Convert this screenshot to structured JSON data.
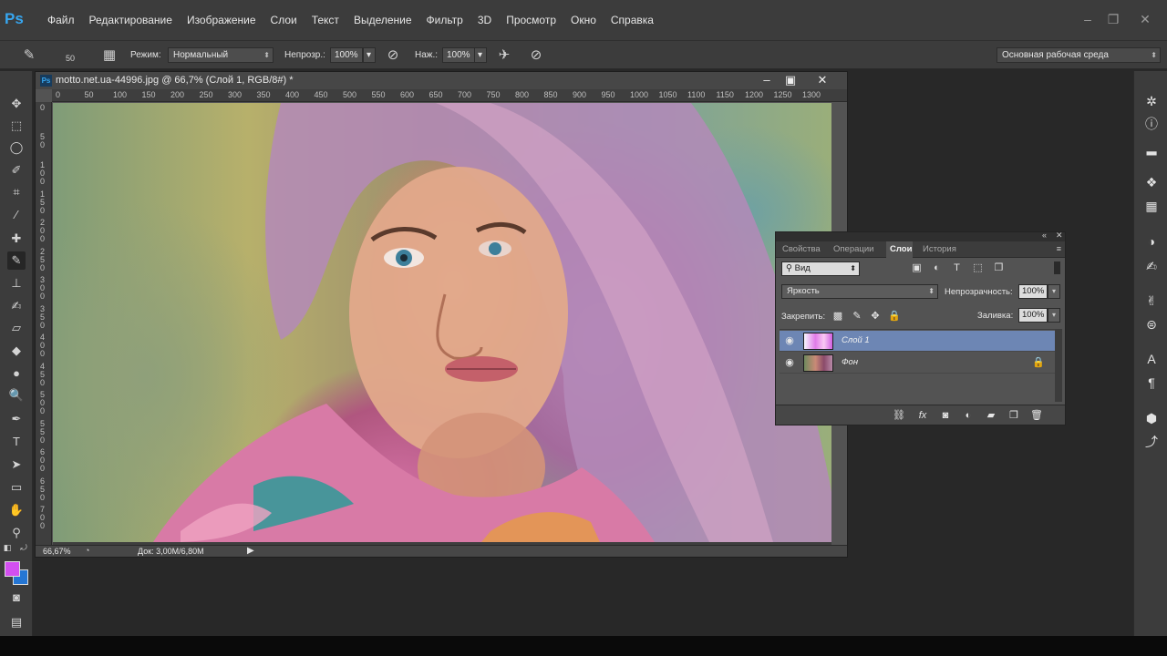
{
  "app": {
    "logo": "Ps",
    "menu": [
      "Файл",
      "Редактирование",
      "Изображение",
      "Слои",
      "Текст",
      "Выделение",
      "Фильтр",
      "3D",
      "Просмотр",
      "Окно",
      "Справка"
    ]
  },
  "options": {
    "brush_size": "50",
    "mode_label": "Режим:",
    "mode_value": "Нормальный",
    "opacity_label": "Непрозр.:",
    "opacity_value": "100%",
    "flow_label": "Наж.:",
    "flow_value": "100%",
    "workspace": "Основная рабочая среда"
  },
  "colors": {
    "foreground": "#d34ff0",
    "background": "#2576d4",
    "selected_layer": "#6d86b4"
  },
  "document": {
    "title": "motto.net.ua-44996.jpg @ 66,7% (Слой 1, RGB/8#) *",
    "ruler_top": [
      "0",
      "50",
      "100",
      "150",
      "200",
      "250",
      "300",
      "350",
      "400",
      "450",
      "500",
      "550",
      "600",
      "650",
      "700",
      "750",
      "800",
      "850",
      "900",
      "950",
      "1000",
      "1050",
      "1100",
      "1150",
      "1200",
      "1250",
      "1300"
    ],
    "ruler_left": [
      "0",
      "5 0",
      "1 0 0",
      "1 5 0",
      "2 0 0",
      "2 5 0",
      "3 0 0",
      "3 5 0",
      "4 0 0",
      "4 5 0",
      "5 0 0",
      "5 5 0",
      "6 0 0",
      "6 5 0",
      "7 0 0"
    ],
    "zoom": "66,67%",
    "doc_size": "Док: 3,00M/6,80M"
  },
  "layers_panel": {
    "tabs": [
      "Свойства",
      "Операции",
      "Слои",
      "История"
    ],
    "active_tab": "Слои",
    "filter_kind": "Вид",
    "blend_mode": "Яркость",
    "opacity_label": "Непрозрачность:",
    "opacity_value": "100%",
    "lock_label": "Закрепить:",
    "fill_label": "Заливка:",
    "fill_value": "100%",
    "layers": [
      {
        "name": "Слой 1",
        "selected": true
      },
      {
        "name": "Фон",
        "selected": false
      }
    ]
  }
}
